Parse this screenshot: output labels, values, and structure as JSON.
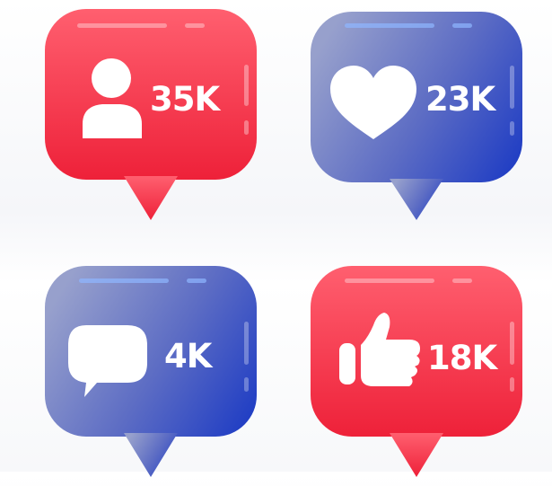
{
  "colors": {
    "red_top": "#ff5a6b",
    "red_bottom": "#f1283f",
    "blue_left": "#8e97c9",
    "blue_right": "#2f48c4",
    "white": "#ffffff"
  },
  "badges": [
    {
      "id": "followers",
      "icon": "person-icon",
      "count": "35K",
      "theme": "red"
    },
    {
      "id": "likes",
      "icon": "heart-icon",
      "count": "23K",
      "theme": "blue"
    },
    {
      "id": "comments",
      "icon": "speech-bubble-icon",
      "count": "4K",
      "theme": "blue"
    },
    {
      "id": "thumbs",
      "icon": "thumbs-up-icon",
      "count": "18K",
      "theme": "red"
    }
  ]
}
